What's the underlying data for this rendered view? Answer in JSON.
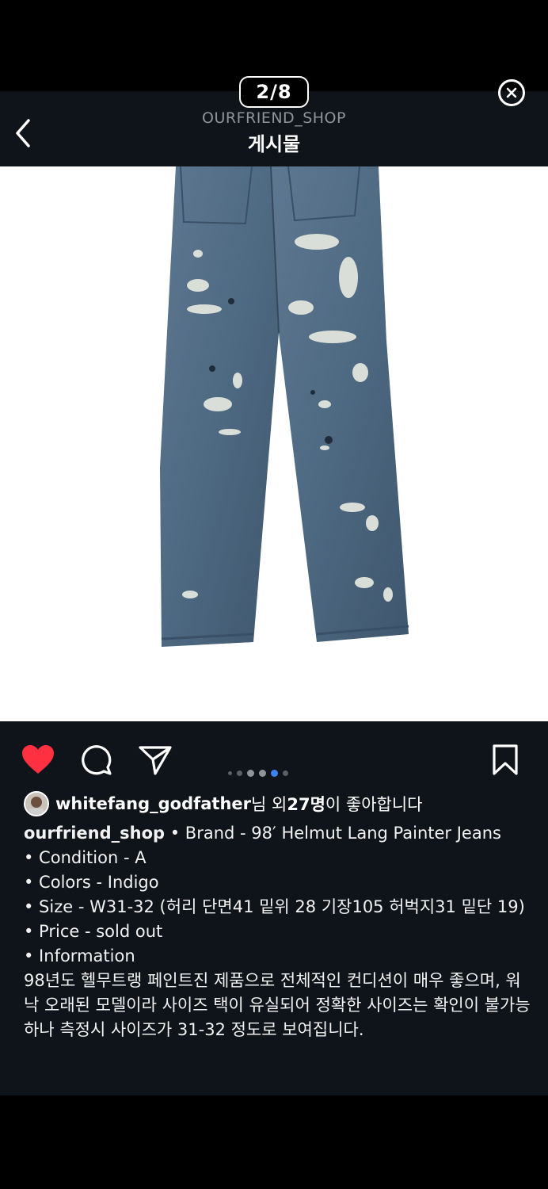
{
  "header": {
    "counter": "2/8",
    "shop_name": "OURFRIEND_SHOP",
    "title": "게시물",
    "back_icon": "chevron-left-icon",
    "close_icon": "close-circle-icon"
  },
  "photo": {
    "subject": "jeans-photo"
  },
  "actions": {
    "like_color": "#ff3040",
    "carousel": {
      "total_dots": 5,
      "active_index": 3
    },
    "accent": "#3b82f6"
  },
  "likes": {
    "user": "whitefang_godfather",
    "suffix_1": "님 외 ",
    "count": "27명",
    "suffix_2": "이 좋아합니다"
  },
  "caption": {
    "username": "ourfriend_shop",
    "line_brand": " • Brand - 98′ Helmut Lang Painter Jeans",
    "line_condition": "• Condition -  A",
    "line_colors": "• Colors - Indigo",
    "line_size": "• Size - W31-32 (허리 단면41 밑위 28 기장105 허벅지31 밑단 19)",
    "line_price": "• Price -  sold out",
    "line_info": "• Information",
    "description": "98년도 헬무트랭 페인트진 제품으로 전체적인 컨디션이 매우 좋으며, 워낙 오래된 모델이라 사이즈 택이 유실되어 정확한 사이즈는 확인이 불가능하나 측정시 사이즈가 31-32 정도로 보여집니다."
  }
}
